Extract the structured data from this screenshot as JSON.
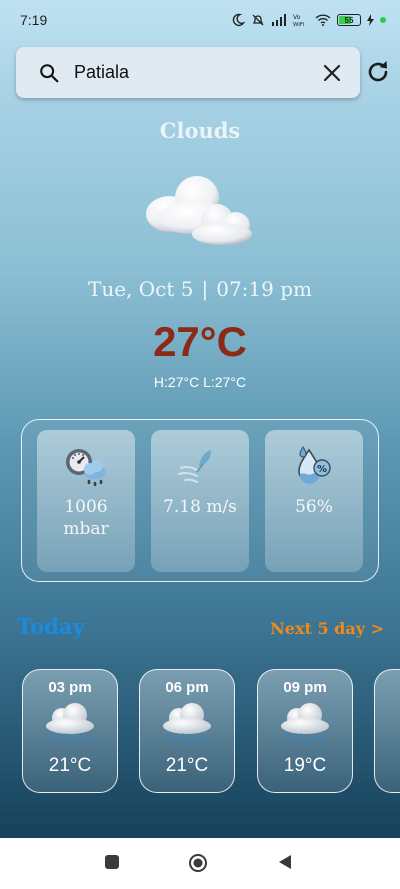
{
  "status_bar": {
    "time": "7:19",
    "battery": "55"
  },
  "search": {
    "value": "Patiala"
  },
  "weather": {
    "condition": "Clouds",
    "date": "Tue, Oct 5",
    "separator": "|",
    "time": "07:19 pm",
    "temperature": "27°C",
    "hilo": "H:27°C L:27°C"
  },
  "stats": {
    "pressure": {
      "value": "1006",
      "unit": "mbar"
    },
    "wind": {
      "value": "7.18 m/s"
    },
    "humidity": {
      "value": "56%"
    }
  },
  "forecast": {
    "today_label": "Today",
    "next_label": "Next 5 day >",
    "hours": [
      {
        "time": "03 pm",
        "temp": "21°C",
        "icon": "rain-cloud-icon"
      },
      {
        "time": "06 pm",
        "temp": "21°C",
        "icon": "rain-cloud-icon"
      },
      {
        "time": "09 pm",
        "temp": "19°C",
        "icon": "rain-cloud-icon"
      }
    ]
  },
  "colors": {
    "temperature": "#8a2a17",
    "today": "#1a8ce0",
    "next": "#ef8a1c"
  }
}
